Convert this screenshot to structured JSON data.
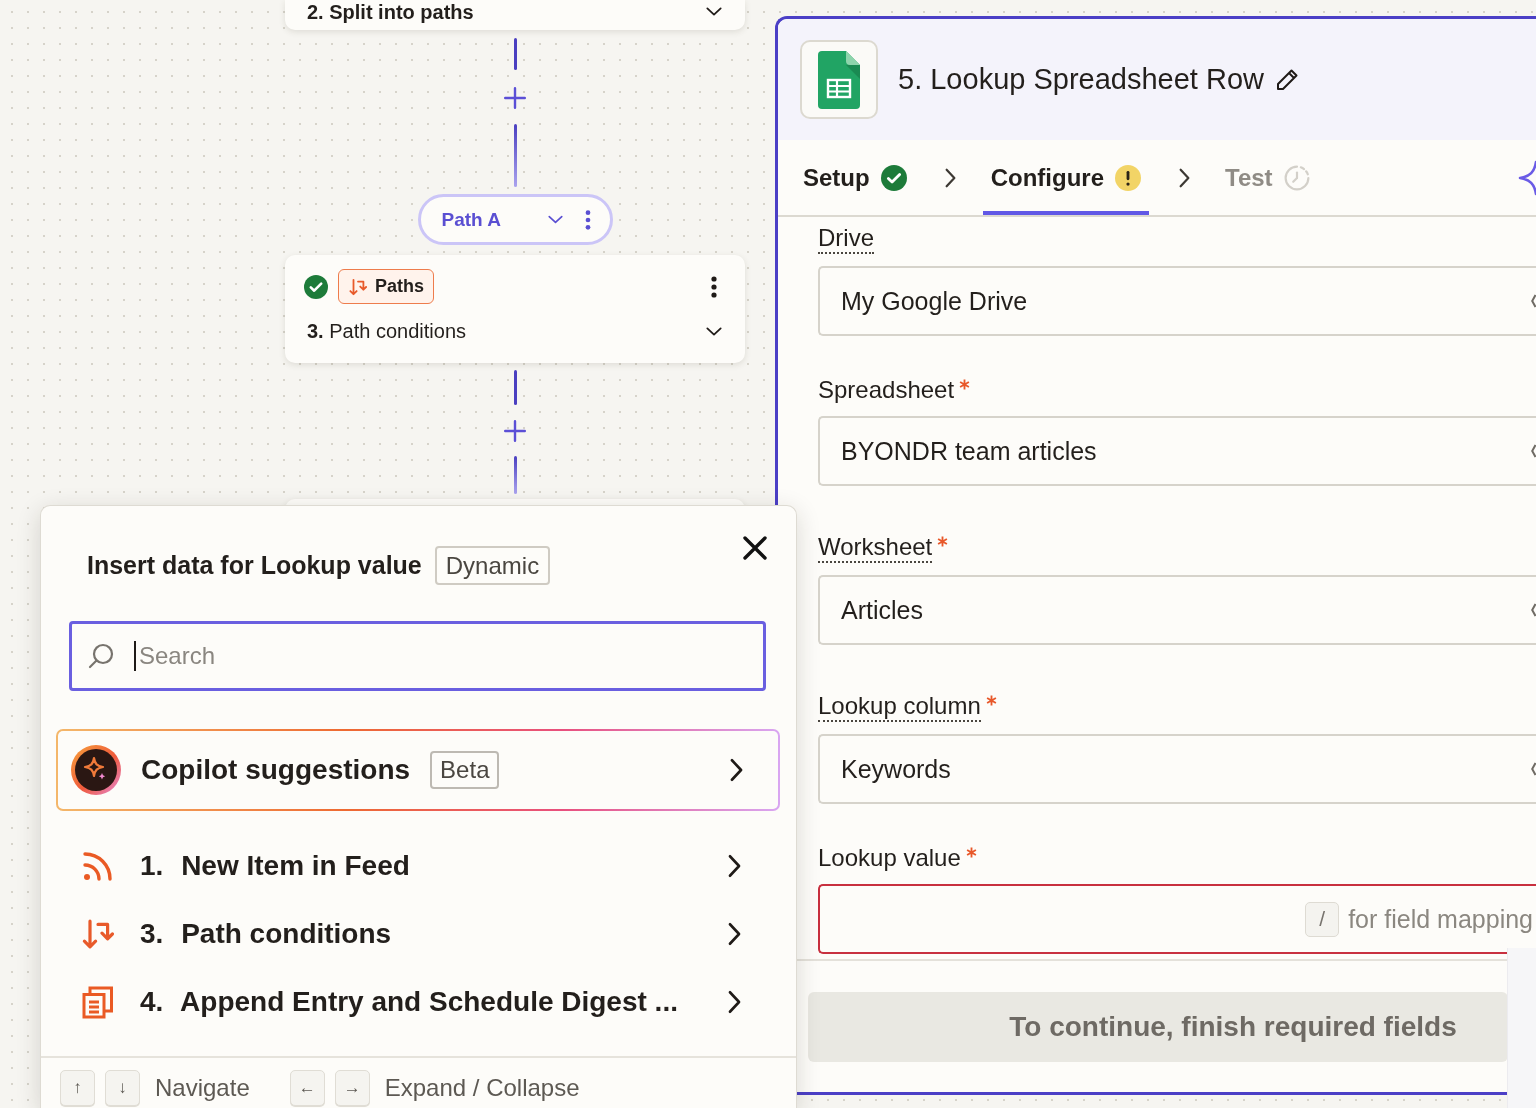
{
  "canvas": {
    "previous_step": {
      "title": "2. Split into paths"
    },
    "path": {
      "label": "Path A"
    },
    "step": {
      "complete": true,
      "app": {
        "name": "Paths",
        "kind": "paths"
      },
      "title": "**3.** Path conditions"
    }
  },
  "editor": {
    "title": "5. Lookup Spreadsheet Row",
    "tabs": [
      {
        "label": "Setup",
        "complete": true,
        "warning": false,
        "selected": false,
        "disabled": false
      },
      {
        "label": "Configure",
        "complete": false,
        "warning": true,
        "selected": true,
        "disabled": false
      },
      {
        "label": "Test",
        "complete": false,
        "warning": false,
        "selected": false,
        "disabled": true
      }
    ],
    "fields": [
      {
        "kind": "select",
        "label": "Drive",
        "required": false,
        "has_help": true,
        "error": false,
        "value": "My Google Drive"
      },
      {
        "kind": "select",
        "label": "Spreadsheet",
        "required": true,
        "has_help": false,
        "error": false,
        "value": "BYONDR team articles"
      },
      {
        "kind": "select",
        "label": "Worksheet",
        "required": true,
        "has_help": true,
        "error": false,
        "value": "Articles"
      },
      {
        "kind": "select",
        "label": "Lookup column",
        "required": true,
        "has_help": true,
        "error": false,
        "value": "Keywords"
      },
      {
        "kind": "text",
        "label": "Lookup value",
        "required": true,
        "has_help": false,
        "error": true,
        "shortcut_key": "/",
        "hint": "for field mapping"
      }
    ],
    "continue_button": {
      "label": "To continue, finish required fields",
      "disabled": true
    }
  },
  "insert_data_popup": {
    "title": "Insert data for Lookup value",
    "badge": "Dynamic",
    "search": {
      "placeholder": "Search",
      "focused": true
    },
    "copilot": {
      "label": "Copilot suggestions",
      "badge": "Beta"
    },
    "steps": [
      {
        "kind": "feed",
        "number": "1.",
        "title": "New Item in Feed"
      },
      {
        "kind": "paths",
        "number": "3.",
        "title": "Path conditions"
      },
      {
        "kind": "digest",
        "number": "4.",
        "title": "Append Entry and Schedule Digest ..."
      }
    ],
    "shortcuts": [
      {
        "keys": [
          "↑",
          "↓"
        ],
        "label": "Navigate"
      },
      {
        "keys": [
          "←",
          "→"
        ],
        "label": "Expand / Collapse"
      }
    ]
  }
}
